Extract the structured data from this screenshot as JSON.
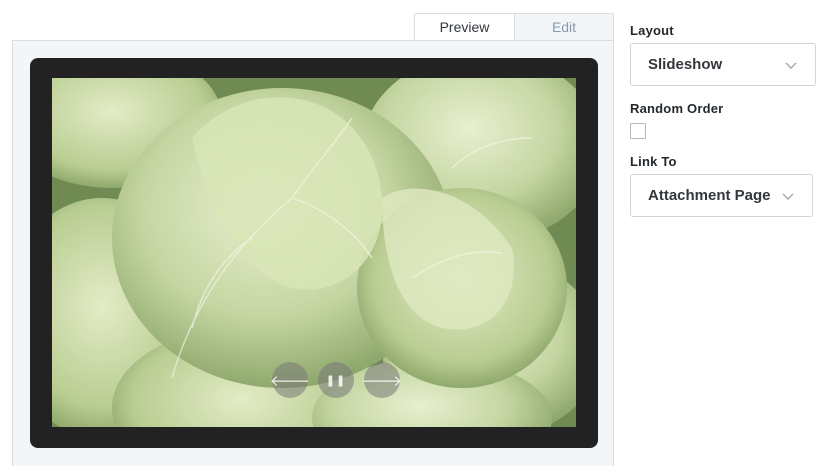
{
  "tabs": [
    {
      "label": "Preview",
      "active": true
    },
    {
      "label": "Edit",
      "active": false
    }
  ],
  "preview": {
    "image_subject": "cabbage heads",
    "controls": {
      "prev_glyph": "🡐",
      "pause_glyph": "❚❚",
      "next_glyph": "🡒"
    }
  },
  "settings": {
    "layout": {
      "label": "Layout",
      "value": "Slideshow"
    },
    "random_order": {
      "label": "Random Order",
      "checked": false
    },
    "link_to": {
      "label": "Link To",
      "value": "Attachment Page"
    }
  },
  "colors": {
    "frame": "#222222",
    "panel_bg": "#f3f6f8",
    "border": "#d8dde2",
    "text": "#23282d",
    "muted_tab": "#8a9aa9"
  }
}
